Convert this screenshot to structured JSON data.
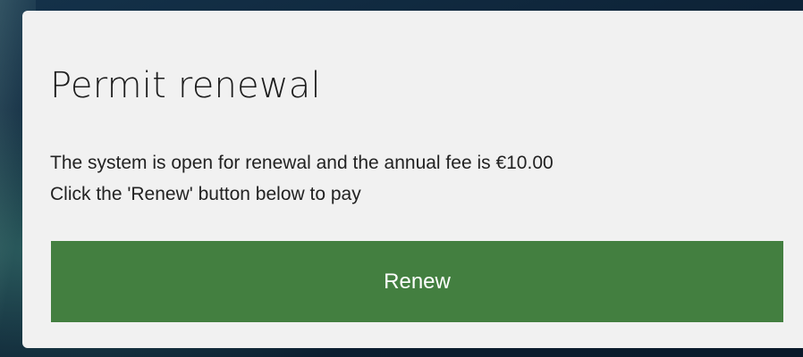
{
  "card": {
    "title": "Permit renewal",
    "message_line1": "The system is open for renewal and the annual fee is €10.00",
    "message_line2": "Click the 'Renew' button below to pay",
    "renew_label": "Renew"
  },
  "colors": {
    "button_bg": "#437f40",
    "card_bg": "#f1f1f1",
    "backdrop": "#0d2236"
  }
}
